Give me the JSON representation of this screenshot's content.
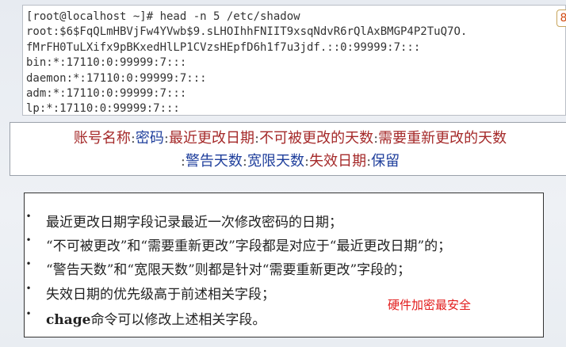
{
  "terminal": {
    "lines": [
      "[root@localhost ~]# head -n 5 /etc/shadow",
      "root:$6$FqQLmHBVjFw4YVwb$9.sLHOIhhFNIIT9xsqNdvR6rQlAxBMGP4P2TuQ7O.",
      "fMrFH0TuLXifx9pBKxedHlLP1CVzsHEpfD6h1f7u3jdf.::0:99999:7:::",
      "bin:*:17110:0:99999:7:::",
      "daemon:*:17110:0:99999:7:::",
      "adm:*:17110:0:99999:7:::",
      "lp:*:17110:0:99999:7:::"
    ],
    "corner_tab": "8"
  },
  "fields": {
    "sep": ":",
    "row1": [
      "账号名称",
      "密码",
      "最近更改日期",
      "不可被更改的天数",
      "需要重新更改的天数"
    ],
    "row2": [
      "警告天数",
      "宽限天数",
      "失效日期",
      "保留"
    ]
  },
  "notes": {
    "bullet": "•",
    "items": [
      {
        "pre": "",
        "bold": "",
        "text": "最近更改日期字段记录最近一次修改密码的日期；"
      },
      {
        "pre": "",
        "bold": "",
        "text": "“不可被更改”和“需要重新更改”字段都是对应于“最近更改日期”的；"
      },
      {
        "pre": "",
        "bold": "",
        "text": "“警告天数”和“宽限天数”则都是针对“需要重新更改”字段的；"
      },
      {
        "pre": "",
        "bold": "",
        "text": "失效日期的优先级高于前述相关字段；"
      },
      {
        "pre": "",
        "bold": "chage",
        "text": "命令可以修改上述相关字段。"
      }
    ],
    "highlight": "硬件加密最安全"
  },
  "colors": {
    "field_red": "#a52a2a",
    "field_blue": "#1f3f9c",
    "highlight_red": "#e21b1b"
  }
}
